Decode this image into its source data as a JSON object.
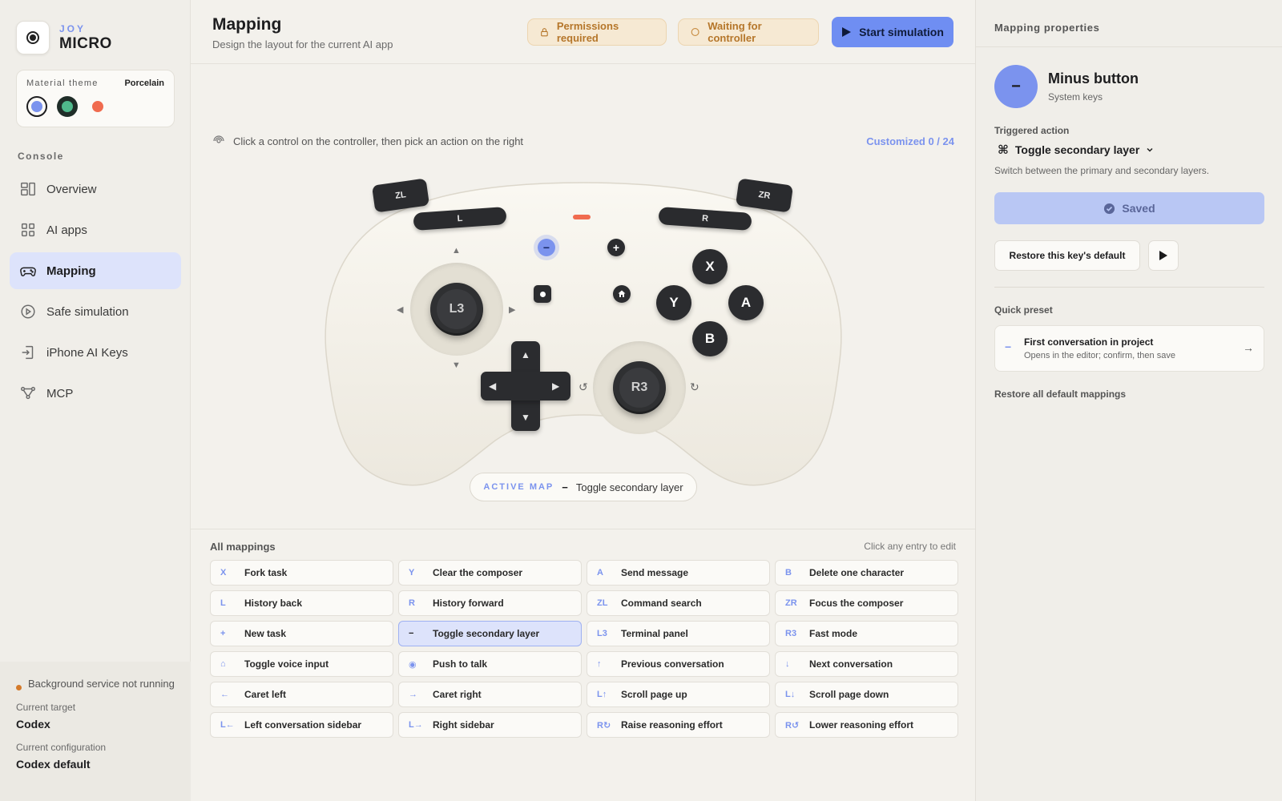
{
  "brand": {
    "top": "JOY",
    "bottom": "MICRO"
  },
  "theme": {
    "label": "Material theme",
    "value": "Porcelain",
    "swatches": [
      "#7b93ee",
      "#4fb98c",
      "#f06b4f"
    ]
  },
  "sidebar": {
    "section": "Console",
    "items": [
      {
        "label": "Overview",
        "icon": "overview-icon"
      },
      {
        "label": "AI apps",
        "icon": "grid-icon"
      },
      {
        "label": "Mapping",
        "icon": "gamepad-icon"
      },
      {
        "label": "Safe simulation",
        "icon": "play-circle-icon"
      },
      {
        "label": "iPhone AI Keys",
        "icon": "login-icon"
      },
      {
        "label": "MCP",
        "icon": "nodes-icon"
      }
    ],
    "footer": {
      "service": "Background service not running",
      "target_label": "Current target",
      "target_value": "Codex",
      "config_label": "Current configuration",
      "config_value": "Codex default"
    }
  },
  "header": {
    "title": "Mapping",
    "subtitle": "Design the layout for the current AI app",
    "permissions": "Permissions required",
    "waiting": "Waiting for controller",
    "start": "Start simulation"
  },
  "hint": "Click a control on the controller, then pick an action on the right",
  "customized": "Customized 0 / 24",
  "controller": {
    "zl": "ZL",
    "zr": "ZR",
    "l": "L",
    "r": "R",
    "l3": "L3",
    "r3": "R3",
    "x": "X",
    "y": "Y",
    "a": "A",
    "b": "B",
    "minus": "−",
    "plus": "+",
    "active_label": "ACTIVE MAP",
    "active_key": "−",
    "active_value": "Toggle secondary layer"
  },
  "mappings": {
    "title": "All mappings",
    "hint": "Click any entry to edit",
    "entries": [
      {
        "key": "X",
        "action": "Fork task"
      },
      {
        "key": "Y",
        "action": "Clear the composer"
      },
      {
        "key": "A",
        "action": "Send message"
      },
      {
        "key": "B",
        "action": "Delete one character"
      },
      {
        "key": "L",
        "action": "History back"
      },
      {
        "key": "R",
        "action": "History forward"
      },
      {
        "key": "ZL",
        "action": "Command search"
      },
      {
        "key": "ZR",
        "action": "Focus the composer"
      },
      {
        "key": "+",
        "action": "New task"
      },
      {
        "key": "−",
        "action": "Toggle secondary layer"
      },
      {
        "key": "L3",
        "action": "Terminal panel"
      },
      {
        "key": "R3",
        "action": "Fast mode"
      },
      {
        "key": "⌂",
        "action": "Toggle voice input"
      },
      {
        "key": "◉",
        "action": "Push to talk"
      },
      {
        "key": "↑",
        "action": "Previous conversation"
      },
      {
        "key": "↓",
        "action": "Next conversation"
      },
      {
        "key": "←",
        "action": "Caret left"
      },
      {
        "key": "→",
        "action": "Caret right"
      },
      {
        "key": "L↑",
        "action": "Scroll page up"
      },
      {
        "key": "L↓",
        "action": "Scroll page down"
      },
      {
        "key": "L←",
        "action": "Left conversation sidebar"
      },
      {
        "key": "L→",
        "action": "Right sidebar"
      },
      {
        "key": "R↻",
        "action": "Raise reasoning effort"
      },
      {
        "key": "R↺",
        "action": "Lower reasoning effort"
      }
    ]
  },
  "panel": {
    "title": "Mapping properties",
    "key_symbol": "−",
    "key_name": "Minus button",
    "key_group": "System keys",
    "triggered_label": "Triggered action",
    "triggered_value": "Toggle secondary layer",
    "triggered_desc": "Switch between the primary and secondary layers.",
    "saved": "Saved",
    "restore_key": "Restore this key's default",
    "quick_label": "Quick preset",
    "preset_key": "−",
    "preset_title": "First conversation in project",
    "preset_sub": "Opens in the editor; confirm, then save",
    "restore_all": "Restore all default mappings"
  },
  "colors": {
    "accent": "#7b93ee",
    "warn": "#b5762a",
    "led": "#f06b4f",
    "selected_bg": "#dde3fb"
  }
}
